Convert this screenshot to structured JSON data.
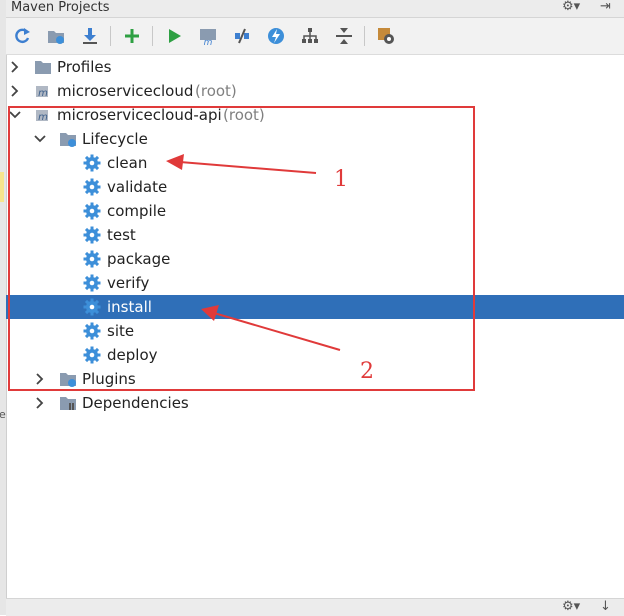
{
  "panel": {
    "title": "Maven Projects"
  },
  "title_controls": {
    "settings": "⚙▾",
    "hide": "⇥"
  },
  "bottom_controls": {
    "settings": "⚙▾",
    "hide": "↓"
  },
  "left_strip": {
    "letter": "e"
  },
  "toolbar": {
    "buttons": [
      {
        "name": "reimport-icon"
      },
      {
        "name": "generate-sources-icon"
      },
      {
        "name": "download-sources-icon"
      },
      {
        "name": "add-project-icon"
      },
      {
        "name": "run-icon"
      },
      {
        "name": "execute-goal-icon"
      },
      {
        "name": "toggle-offline-icon"
      },
      {
        "name": "skip-tests-icon"
      },
      {
        "name": "show-dependencies-icon"
      },
      {
        "name": "collapse-all-icon"
      },
      {
        "name": "maven-settings-icon"
      }
    ]
  },
  "tree": {
    "profiles": {
      "label": "Profiles"
    },
    "project1": {
      "label": "microservicecloud",
      "suffix": "(root)"
    },
    "project2": {
      "label": "microservicecloud-api",
      "suffix": "(root)"
    },
    "lifecycle": {
      "label": "Lifecycle"
    },
    "goals": [
      "clean",
      "validate",
      "compile",
      "test",
      "package",
      "verify",
      "install",
      "site",
      "deploy"
    ],
    "selected_goal": "install",
    "plugins": {
      "label": "Plugins"
    },
    "dependencies": {
      "label": "Dependencies"
    }
  },
  "annotations": {
    "label1": "1",
    "label2": "2",
    "color": "#e03a3a"
  },
  "colors": {
    "selection": "#2f6fb8",
    "gear": "#3d8fd9",
    "folder": "#8a9bb0",
    "run": "#2ea043"
  }
}
